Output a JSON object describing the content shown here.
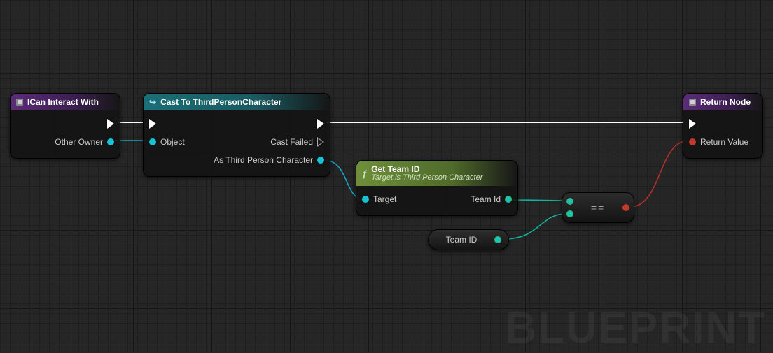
{
  "watermark": "BLUEPRINT",
  "nodes": {
    "interact": {
      "title": "ICan Interact With",
      "out_pin": "Other Owner"
    },
    "cast": {
      "title": "Cast To ThirdPersonCharacter",
      "in_obj": "Object",
      "out_fail": "Cast Failed",
      "out_as": "As Third Person Character"
    },
    "getteam": {
      "title": "Get Team ID",
      "subtitle": "Target is Third Person Character",
      "in_target": "Target",
      "out_teamid": "Team Id"
    },
    "teamvar": {
      "label": "Team ID"
    },
    "equals": {
      "symbol": "=="
    },
    "return": {
      "title": "Return Node",
      "in_val": "Return Value"
    }
  }
}
